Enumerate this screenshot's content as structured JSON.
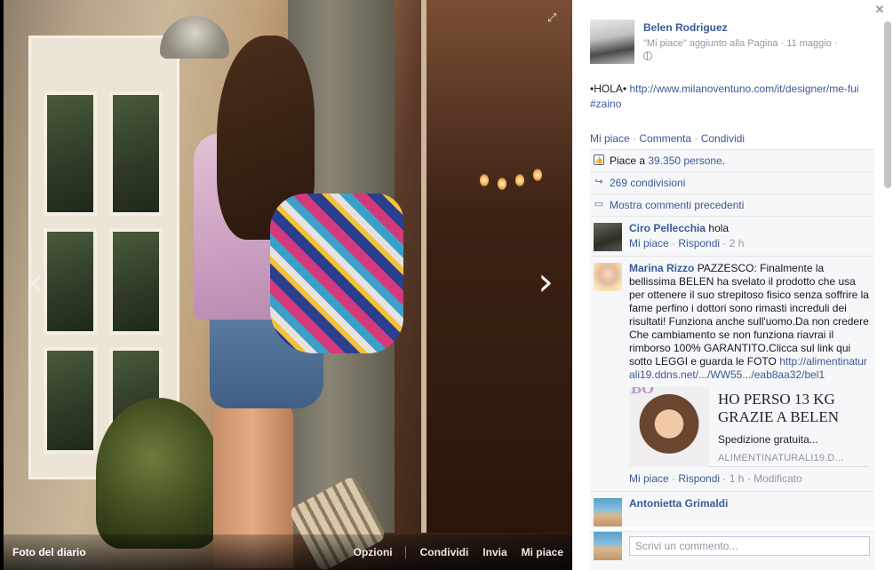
{
  "photo": {
    "caption": "Foto del diario",
    "actions": [
      "Opzioni",
      "Condividi",
      "Invia",
      "Mi piace"
    ]
  },
  "post": {
    "author": "Belen Rodriguez",
    "meta": "\"Mi piace\" aggiunto alla Pagina · 11 maggio ·",
    "text_prefix": "•HOLA•",
    "link": "http://www.milanoventuno.com/it/designer/me-fui",
    "hashtag": "#zaino",
    "actions": [
      "Mi piace",
      "Commenta",
      "Condividi"
    ]
  },
  "ufi": {
    "likes_prefix": "Piace a",
    "likes_count": "39.350 persone",
    "shares": "269 condivisioni",
    "previous_comments": "Mostra commenti precedenti"
  },
  "comments": [
    {
      "name": "Ciro Pellecchia",
      "text": "hola",
      "like": "Mi piace",
      "reply": "Rispondi",
      "time": "2 h"
    },
    {
      "name": "Marina Rizzo",
      "text": "PAZZESCO: Finalmente la bellissima BELEN ha svelato il prodotto che usa per ottenere il suo strepitoso fisico senza soffrire la fame perfino i dottori sono rimasti increduli dei risultati! Funziona anche sull'uomo.Da non credere Che cambiamento se non funziona riavrai il rimborso 100% GARANTITO.Clicca sul link qui sotto LEGGI e guarda le FOTO",
      "link": "http://alimentinaturali19.ddns.net/.../WW55.../eab8aa32/bel1",
      "ad": {
        "title": "HO PERSO 13 KG GRAZIE A BELEN",
        "subtitle": "Spedizione gratuita...",
        "domain": "ALIMENTINATURALI19.D..."
      },
      "like": "Mi piace",
      "reply": "Rispondi",
      "time": "1 h",
      "edited": "Modificato"
    },
    {
      "name": "Antonietta Grimaldi"
    }
  ],
  "composer": {
    "placeholder": "Scrivi un commento..."
  },
  "icons": {
    "close": "close-icon",
    "expand": "expand-icon",
    "prev": "chevron-left-icon",
    "next": "chevron-right-icon",
    "like": "thumbs-up-icon",
    "share": "share-icon",
    "comment": "comment-icon",
    "privacy": "globe-icon"
  },
  "colors": {
    "link": "#3b5998",
    "muted": "#9197a3",
    "ufi_bg": "#f6f7f8"
  }
}
